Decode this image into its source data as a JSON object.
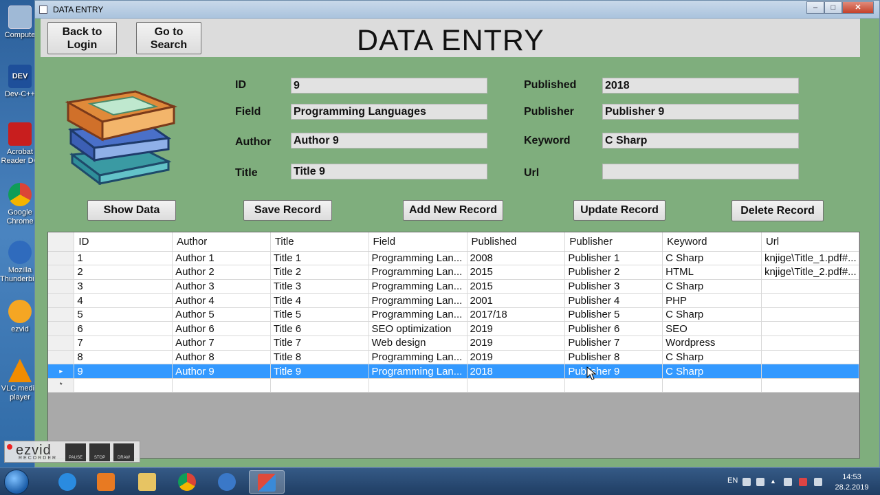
{
  "window": {
    "title": "DATA ENTRY"
  },
  "header": {
    "back_label_line1": "Back to",
    "back_label_line2": "Login",
    "search_label_line1": "Go to",
    "search_label_line2": "Search",
    "page_title": "DATA ENTRY"
  },
  "form": {
    "id": {
      "label": "ID",
      "value": "9"
    },
    "field": {
      "label": "Field",
      "value": "Programming Languages"
    },
    "author": {
      "label": "Author",
      "value": "Author 9"
    },
    "title": {
      "label": "Title",
      "value": "Title 9"
    },
    "published": {
      "label": "Published",
      "value": "2018"
    },
    "publisher": {
      "label": "Publisher",
      "value": "Publisher 9"
    },
    "keyword": {
      "label": "Keyword",
      "value": "C Sharp"
    },
    "url": {
      "label": "Url",
      "value": ""
    }
  },
  "actions": {
    "show_data": "Show Data",
    "save_record": "Save Record",
    "add_new_record": "Add New Record",
    "update_record": "Update Record",
    "delete_record": "Delete Record"
  },
  "grid": {
    "columns": [
      "ID",
      "Author",
      "Title",
      "Field",
      "Published",
      "Publisher",
      "Keyword",
      "Url"
    ],
    "rows": [
      [
        "1",
        "Author 1",
        "Title 1",
        "Programming Lan...",
        "2008",
        "Publisher 1",
        "C Sharp",
        "knjige\\Title_1.pdf#..."
      ],
      [
        "2",
        "Author 2",
        "Title 2",
        "Programming Lan...",
        "2015",
        "Publisher 2",
        "HTML",
        "knjige\\Title_2.pdf#..."
      ],
      [
        "3",
        "Author 3",
        "Title 3",
        "Programming Lan...",
        "2015",
        "Publisher 3",
        "C Sharp",
        ""
      ],
      [
        "4",
        "Author 4",
        "Title 4",
        "Programming Lan...",
        "2001",
        "Publisher 4",
        "PHP",
        ""
      ],
      [
        "5",
        "Author 5",
        "Title 5",
        "Programming Lan...",
        "2017/18",
        "Publisher 5",
        "C Sharp",
        ""
      ],
      [
        "6",
        "Author 6",
        "Title 6",
        "SEO optimization",
        "2019",
        "Publisher 6",
        "SEO",
        ""
      ],
      [
        "7",
        "Author 7",
        "Title 7",
        "Web design",
        "2019",
        "Publisher 7",
        "Wordpress",
        ""
      ],
      [
        "8",
        "Author 8",
        "Title 8",
        "Programming Lan...",
        "2019",
        "Publisher 8",
        "C Sharp",
        ""
      ],
      [
        "9",
        "Author 9",
        "Title 9",
        "Programming Lan...",
        "2018",
        "Publisher 9",
        "C Sharp",
        ""
      ]
    ],
    "selected_row_index": 8,
    "selected_marker": "▸",
    "new_row_marker": "*"
  },
  "desktop_icons": [
    {
      "label": "Compute",
      "icon": "computer-icon"
    },
    {
      "label": "Dev-C++",
      "icon": "devcpp-icon"
    },
    {
      "label": "Acrobat Reader DC",
      "icon": "acrobat-icon"
    },
    {
      "label": "Google Chrome",
      "icon": "chrome-icon"
    },
    {
      "label": "Mozilla Thunderbird",
      "icon": "thunderbird-icon"
    },
    {
      "label": "ezvid",
      "icon": "ezvid-icon"
    },
    {
      "label": "VLC media player",
      "icon": "vlc-icon"
    }
  ],
  "ezvid": {
    "logo": "ezvid",
    "subtitle": "RECORDER",
    "pause": "PAUSE",
    "stop": "STOP",
    "draw": "DRAW"
  },
  "taskbar": {
    "lang": "EN",
    "time": "14:53",
    "date": "28.2.2019"
  },
  "colors": {
    "form_bg": "#7fae7d",
    "selection": "#3399ff",
    "header_bg": "#dcdcdc"
  }
}
